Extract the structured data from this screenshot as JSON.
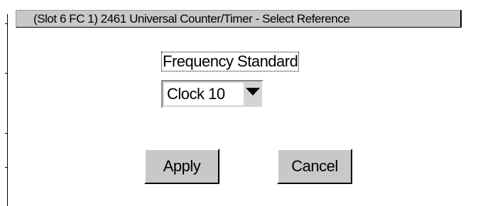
{
  "window": {
    "title": "(Slot 6 FC 1) 2461 Universal Counter/Timer - Select Reference"
  },
  "form": {
    "frequency_standard_label": "Frequency Standard",
    "frequency_standard_value": "Clock 10"
  },
  "buttons": {
    "apply_label": "Apply",
    "cancel_label": "Cancel"
  },
  "colors": {
    "titlebar": "#c8c8c8",
    "button_face": "#c8c8c8",
    "background": "#ffffff"
  },
  "icons": {
    "dropdown": "triangle-down-icon"
  }
}
